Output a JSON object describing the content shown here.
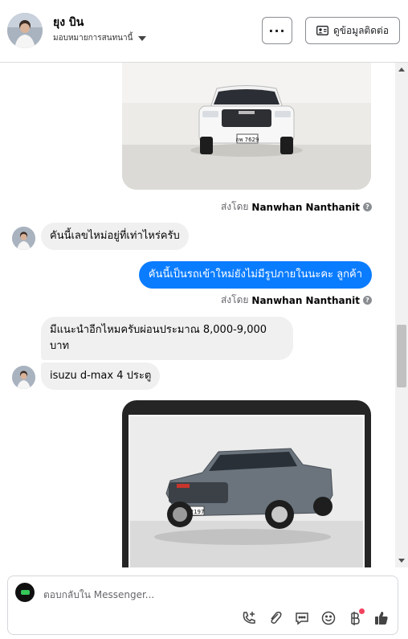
{
  "header": {
    "contact_name": "ยุง บิน",
    "assign_label": "มอบหมายการสนทนานี้",
    "more_label": "···",
    "contact_info_label": "ดูข้อมูลติดต่อ"
  },
  "messages": {
    "sent_by_prefix": "ส่งโดย",
    "sent_by_name": "Nanwhan Nanthanit",
    "sent_by_help": "?",
    "m1": "คันนี้เลขไหม่อยู่ที่เท่าไหร่ครับ",
    "m2": "คันนี้เป็นรถเข้าใหม่ยังไม่มีรูปภายในนะคะ ลูกค้า",
    "m3": "มีแนะนำอีกไหมครับผ่อนประมาณ 8,000-9,000 บาท",
    "m4": "isuzu d-max 4 ประตู",
    "plate_top": "กพ 7629",
    "plate_bottom": "กพ 2197"
  },
  "composer": {
    "placeholder": "ตอบกลับใน Messenger..."
  },
  "icons": [
    "more-icon",
    "contact-card-icon",
    "add-call-icon",
    "attach-icon",
    "saved-replies-icon",
    "emoji-icon",
    "payment-icon",
    "like-icon"
  ],
  "colors": {
    "accent": "#0a7cff",
    "incoming_bubble": "#f0f0f0",
    "notification": "#f3425f"
  }
}
